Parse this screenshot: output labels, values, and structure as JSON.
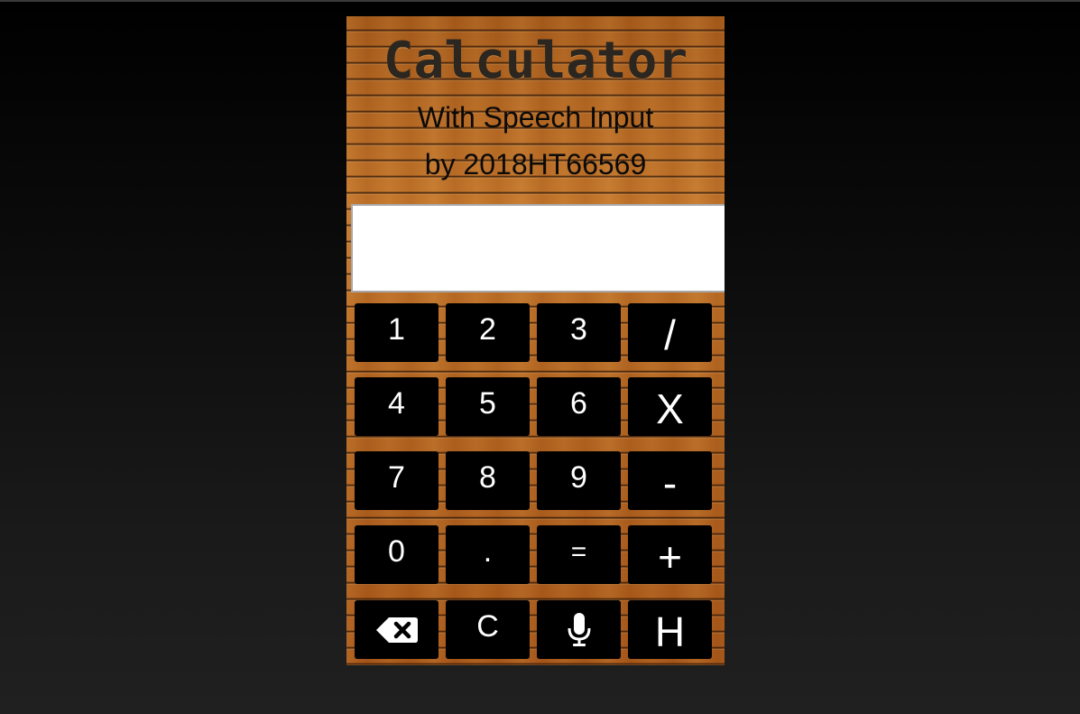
{
  "app": {
    "title": "Calculator",
    "subtitle_line1": "With Speech Input",
    "subtitle_line2": "by 2018HT66569"
  },
  "display": {
    "value": ""
  },
  "keys": {
    "k1": "1",
    "k2": "2",
    "k3": "3",
    "divide": "/",
    "k4": "4",
    "k5": "5",
    "k6": "6",
    "multiply": "X",
    "k7": "7",
    "k8": "8",
    "k9": "9",
    "subtract": "-",
    "k0": "0",
    "decimal": ".",
    "equals": "=",
    "add": "+",
    "backspace_icon": "backspace-icon",
    "clear": "C",
    "mic_icon": "microphone-icon",
    "history": "H"
  },
  "colors": {
    "button_bg": "#000000",
    "button_text": "#ffffff",
    "wood": "#b5671f",
    "title_text": "#2b2620"
  }
}
